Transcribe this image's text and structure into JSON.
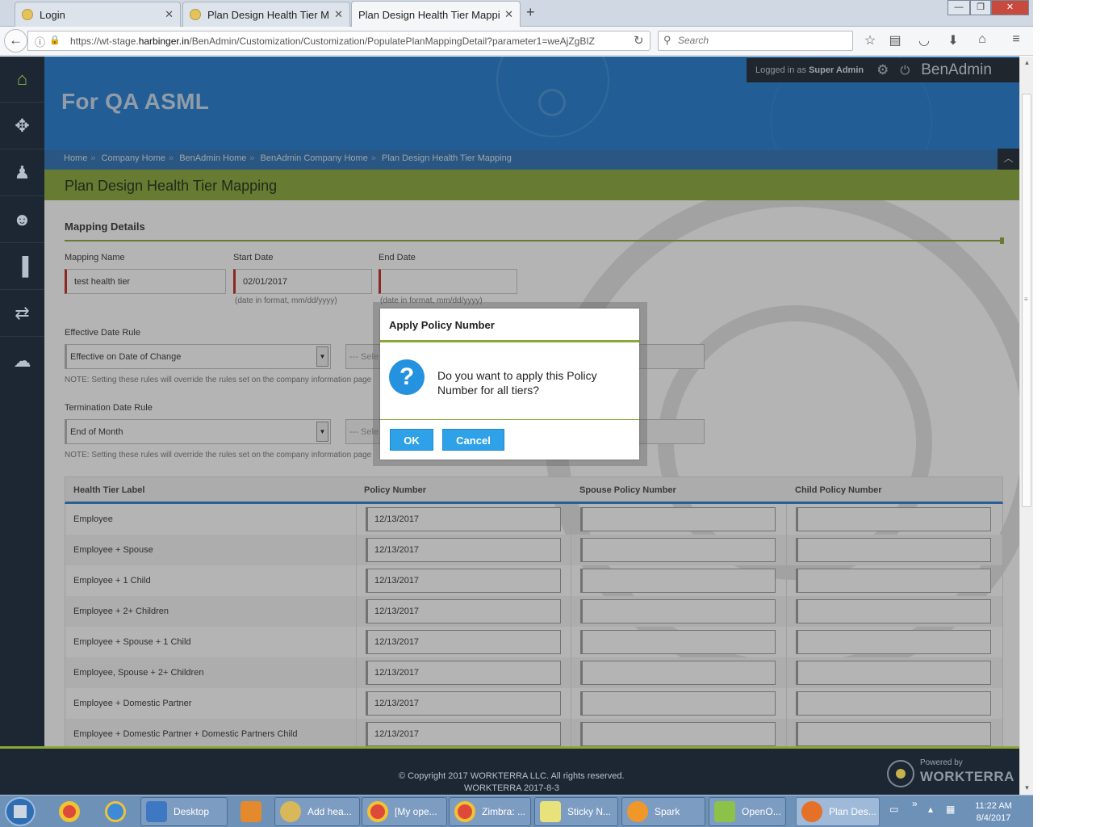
{
  "browser": {
    "tabs": [
      {
        "title": "Login",
        "active": false
      },
      {
        "title": "Plan Design Health Tier Mapping",
        "active": false
      },
      {
        "title": "Plan Design Health Tier Mapping",
        "active": true
      }
    ],
    "url_prefix": "https://wt-stage.",
    "url_domain": "harbinger.in",
    "url_path": "/BenAdmin/Customization/Customization/PopulatePlanMappingDetail?parameter1=weAjZgBIZ",
    "search_placeholder": "Search"
  },
  "app": {
    "company_title": "For QA ASML",
    "logged_in_prefix": "Logged in as",
    "user_name": "Super Admin",
    "brand": "BenAdmin",
    "nav_items": [
      "home-icon",
      "puzzle-icon",
      "user-star-icon",
      "user-icon",
      "bar-chart-icon",
      "transfer-icon",
      "chat-icon"
    ]
  },
  "breadcrumb": [
    "Home",
    "Company Home",
    "BenAdmin Home",
    "BenAdmin Company Home",
    "Plan Design Health Tier Mapping"
  ],
  "page_title": "Plan Design Health Tier Mapping",
  "form": {
    "section_title": "Mapping Details",
    "mapping_name_label": "Mapping Name",
    "mapping_name_value": "test health tier",
    "start_date_label": "Start Date",
    "start_date_value": "02/01/2017",
    "start_date_hint": "(date in format, mm/dd/yyyy)",
    "end_date_label": "End Date",
    "end_date_value": "",
    "end_date_hint": "(date in format, mm/dd/yyyy)",
    "effective_rule_label": "Effective Date Rule",
    "effective_rule_value": "Effective on Date of Change",
    "effective_second_value": "--- Sele",
    "effective_note": "NOTE: Setting these rules will override the rules set on the company information page",
    "termination_rule_label": "Termination Date Rule",
    "termination_rule_value": "End of Month",
    "termination_second_value": "--- Sele",
    "termination_note": "NOTE: Setting these rules will override the rules set on the company information page"
  },
  "table": {
    "headers": [
      "Health Tier Label",
      "Policy Number",
      "Spouse Policy Number",
      "Child Policy Number"
    ],
    "rows": [
      {
        "label": "Employee",
        "policy": "12/13/2017",
        "spouse": "",
        "child": ""
      },
      {
        "label": "Employee + Spouse",
        "policy": "12/13/2017",
        "spouse": "",
        "child": ""
      },
      {
        "label": "Employee + 1 Child",
        "policy": "12/13/2017",
        "spouse": "",
        "child": ""
      },
      {
        "label": "Employee + 2+ Children",
        "policy": "12/13/2017",
        "spouse": "",
        "child": ""
      },
      {
        "label": "Employee + Spouse + 1 Child",
        "policy": "12/13/2017",
        "spouse": "",
        "child": ""
      },
      {
        "label": "Employee, Spouse + 2+ Children",
        "policy": "12/13/2017",
        "spouse": "",
        "child": ""
      },
      {
        "label": "Employee + Domestic Partner",
        "policy": "12/13/2017",
        "spouse": "",
        "child": ""
      },
      {
        "label": "Employee + Domestic Partner + Domestic Partners Child",
        "policy": "12/13/2017",
        "spouse": "",
        "child": ""
      }
    ]
  },
  "dialog": {
    "title": "Apply Policy Number",
    "message": "Do you want to apply this Policy Number for all tiers?",
    "ok_label": "OK",
    "cancel_label": "Cancel"
  },
  "footer": {
    "copyright": "© Copyright 2017 WORKTERRA LLC. All rights reserved.",
    "version": "WORKTERRA 2017-8-3",
    "powered_by": "Powered by",
    "powered_brand": "WORKTERRA"
  },
  "taskbar": {
    "items": [
      {
        "label": "Desktop"
      },
      {
        "label": "Add hea..."
      },
      {
        "label": "[My ope..."
      },
      {
        "label": "Zimbra: ..."
      },
      {
        "label": "Sticky N..."
      },
      {
        "label": "Spark"
      },
      {
        "label": "OpenO..."
      },
      {
        "label": "Plan Des..."
      }
    ],
    "time": "11:22 AM",
    "date": "8/4/2017"
  },
  "colors": {
    "header_blue": "#1f7ccf",
    "accent_green": "#8aa838",
    "nav_dark": "#1d2733",
    "button_blue": "#2ea1e8",
    "required_red": "#c0281f"
  }
}
